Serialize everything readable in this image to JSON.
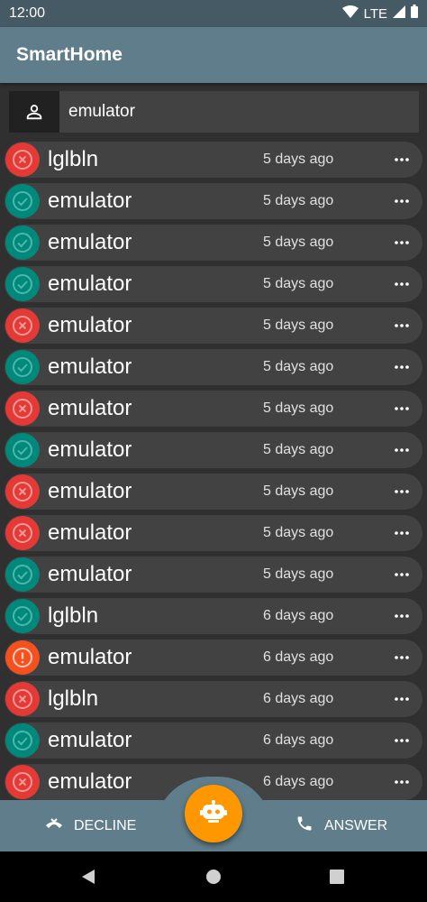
{
  "status_bar": {
    "time": "12:00",
    "network": "LTE"
  },
  "app_bar": {
    "title": "SmartHome"
  },
  "filter": {
    "value": "emulator"
  },
  "colors": {
    "success": "#00897b",
    "error": "#e53935",
    "warning": "#f4511e",
    "fab": "#ff9800"
  },
  "events": [
    {
      "status": "error",
      "name": "lglbln",
      "time": "5 days ago"
    },
    {
      "status": "success",
      "name": "emulator",
      "time": "5 days ago"
    },
    {
      "status": "success",
      "name": "emulator",
      "time": "5 days ago"
    },
    {
      "status": "success",
      "name": "emulator",
      "time": "5 days ago"
    },
    {
      "status": "error",
      "name": "emulator",
      "time": "5 days ago"
    },
    {
      "status": "success",
      "name": "emulator",
      "time": "5 days ago"
    },
    {
      "status": "error",
      "name": "emulator",
      "time": "5 days ago"
    },
    {
      "status": "success",
      "name": "emulator",
      "time": "5 days ago"
    },
    {
      "status": "error",
      "name": "emulator",
      "time": "5 days ago"
    },
    {
      "status": "error",
      "name": "emulator",
      "time": "5 days ago"
    },
    {
      "status": "success",
      "name": "emulator",
      "time": "5 days ago"
    },
    {
      "status": "success",
      "name": "lglbln",
      "time": "6 days ago"
    },
    {
      "status": "warning",
      "name": "emulator",
      "time": "6 days ago"
    },
    {
      "status": "error",
      "name": "lglbln",
      "time": "6 days ago"
    },
    {
      "status": "success",
      "name": "emulator",
      "time": "6 days ago"
    },
    {
      "status": "error",
      "name": "emulator",
      "time": "6 days ago"
    }
  ],
  "bottom_bar": {
    "decline_label": "DECLINE",
    "answer_label": "ANSWER"
  }
}
